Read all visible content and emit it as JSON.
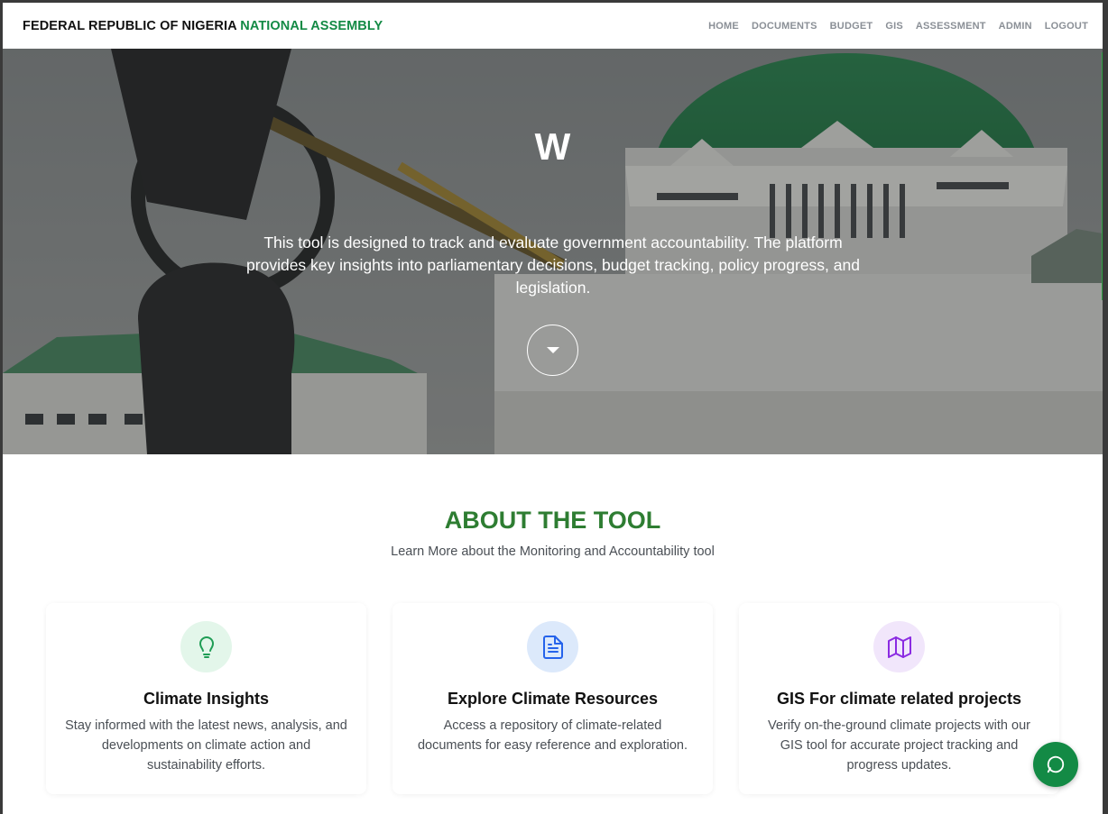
{
  "navbar": {
    "brand_main": "FEDERAL REPUBLIC OF NIGERIA",
    "brand_accent": "NATIONAL ASSEMBLY",
    "links": [
      "HOME",
      "DOCUMENTS",
      "BUDGET",
      "GIS",
      "ASSESSMENT",
      "ADMIN",
      "LOGOUT"
    ]
  },
  "hero": {
    "title": "W",
    "description": "This tool is designed to track and evaluate government accountability. The platform provides key insights into parliamentary decisions, budget tracking, policy progress, and legislation.",
    "scroll_icon": "caret-down-icon"
  },
  "about": {
    "title": "ABOUT THE TOOL",
    "subtitle": "Learn More about the Monitoring and Accountability tool",
    "cards": [
      {
        "icon": "lightbulb-icon",
        "title": "Climate Insights",
        "text": "Stay informed with the latest news, analysis, and developments on climate action and sustainability efforts."
      },
      {
        "icon": "document-icon",
        "title": "Explore Climate Resources",
        "text": "Access a repository of climate-related documents for easy reference and exploration."
      },
      {
        "icon": "map-icon",
        "title": "GIS For climate related projects",
        "text": "Verify on-the-ground climate projects with our GIS tool for accurate project tracking and progress updates."
      }
    ]
  },
  "chat": {
    "icon": "chat-icon"
  },
  "colors": {
    "brand_green": "#138a45",
    "title_green": "#2e7d32",
    "nav_text": "#8a8f96"
  }
}
